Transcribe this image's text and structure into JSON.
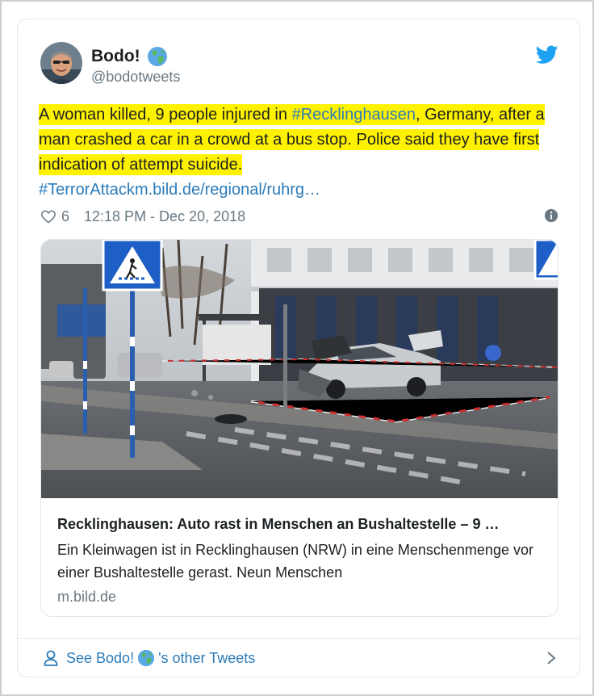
{
  "author": {
    "name": "Bodo!",
    "handle": "@bodotweets"
  },
  "tweet": {
    "seg1": "A woman killed, 9 people injured in ",
    "hashtag1": "#Recklinghausen",
    "seg2": ", Germany, after a man crashed a car in a crowd at a bus stop. Police said they have first indication of attempt suicide.",
    "hashtag2": "#TerrorAttack",
    "link": "m.bild.de/regional/ruhrg…"
  },
  "meta": {
    "likes": "6",
    "timestamp": "12:18 PM - Dec 20, 2018"
  },
  "media_card": {
    "title": "Recklinghausen: Auto rast in Menschen an Bushaltestelle – 9 …",
    "description": "Ein Kleinwagen ist in Recklinghausen (NRW) in eine Menschenmenge vor einer Bushaltestelle gerast. Neun Menschen",
    "domain": "m.bild.de"
  },
  "footer": {
    "see_prefix": "See Bodo! ",
    "see_suffix": "'s other Tweets"
  },
  "colors": {
    "link": "#2b7bb9",
    "highlight": "#fff200",
    "twitter_blue": "#1da1f2",
    "muted": "#697882"
  },
  "icons": [
    "globe-emoji-icon",
    "twitter-bird-icon",
    "heart-icon",
    "info-icon",
    "person-icon",
    "chevron-right-icon"
  ]
}
